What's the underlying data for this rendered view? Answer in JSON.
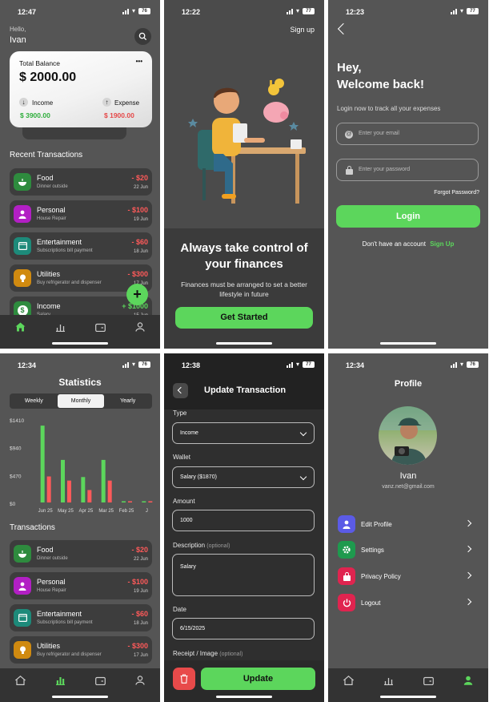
{
  "colors": {
    "green": "#5cd65c",
    "red": "#ff5a5a",
    "bg": "#555555",
    "dark": "#333333"
  },
  "s1": {
    "time": "12:47",
    "battery": "76",
    "greeting": "Hello,",
    "name": "Ivan",
    "balance_label": "Total Balance",
    "balance": "$ 2000.00",
    "more": "•••",
    "income_label": "Income",
    "income": "$ 3900.00",
    "expense_label": "Expense",
    "expense": "$ 1900.00",
    "section": "Recent Transactions",
    "transactions": [
      {
        "name": "Food",
        "sub": "Dinner outside",
        "amount": "- $20",
        "date": "22 Jun",
        "icon": "food-icon",
        "color": "#2e8b3e"
      },
      {
        "name": "Personal",
        "sub": "House Repair",
        "amount": "- $100",
        "date": "19 Jun",
        "icon": "person-icon",
        "color": "#b21fc4"
      },
      {
        "name": "Entertainment",
        "sub": "Subscriptions bill payment",
        "amount": "- $60",
        "date": "18 Jun",
        "icon": "entertainment-icon",
        "color": "#1d8a7a"
      },
      {
        "name": "Utilities",
        "sub": "Buy refrigerator and dispenser",
        "amount": "- $300",
        "date": "17 Jun",
        "icon": "bulb-icon",
        "color": "#d08a10"
      },
      {
        "name": "Income",
        "sub": "Salary",
        "amount": "+ $1000",
        "date": "15 Jun",
        "icon": "dollar-icon",
        "color": "#2e8b3e"
      }
    ],
    "fab": "+"
  },
  "s2": {
    "time": "12:22",
    "battery": "77",
    "signup": "Sign up",
    "headline": "Always take control of your finances",
    "body": "Finances must be arranged to set a better lifestyle in future",
    "cta": "Get Started"
  },
  "s3": {
    "time": "12:23",
    "battery": "77",
    "title1": "Hey,",
    "title2": "Welcome back!",
    "subtitle": "Login now to track all your expenses",
    "email_ph": "Enter your email",
    "password_ph": "Enter your password",
    "forgot": "Forgot Password?",
    "login": "Login",
    "no_account": "Don't have an account",
    "signup": "Sign Up"
  },
  "s4": {
    "time": "12:34",
    "battery": "76",
    "title": "Statistics",
    "periods": [
      "Weekly",
      "Monthly",
      "Yearly"
    ],
    "section": "Transactions",
    "transactions": [
      {
        "name": "Food",
        "sub": "Dinner outside",
        "amount": "- $20",
        "date": "22 Jun",
        "icon": "food-icon",
        "color": "#2e8b3e"
      },
      {
        "name": "Personal",
        "sub": "House Repair",
        "amount": "- $100",
        "date": "19 Jun",
        "icon": "person-icon",
        "color": "#b21fc4"
      },
      {
        "name": "Entertainment",
        "sub": "Subscriptions bill payment",
        "amount": "- $60",
        "date": "18 Jun",
        "icon": "entertainment-icon",
        "color": "#1d8a7a"
      },
      {
        "name": "Utilities",
        "sub": "Buy refrigerator and dispenser",
        "amount": "- $300",
        "date": "17 Jun",
        "icon": "bulb-icon",
        "color": "#d08a10"
      }
    ]
  },
  "chart_data": {
    "type": "bar",
    "categories": [
      "Jun 25",
      "May 25",
      "Apr 25",
      "Mar 25",
      "Feb 25",
      "J"
    ],
    "series": [
      {
        "values": [
          1300,
          720,
          430,
          720,
          0,
          0
        ],
        "color": "#5cd65c"
      },
      {
        "values": [
          440,
          370,
          210,
          370,
          0,
          0
        ],
        "color": "#ff5a5a"
      }
    ],
    "yticks": [
      "$1410",
      "$940",
      "$470",
      "$0"
    ],
    "ylim": [
      0,
      1410
    ]
  },
  "s5": {
    "time": "12:38",
    "battery": "77",
    "title": "Update Transaction",
    "type_label": "Type",
    "type_value": "Income",
    "wallet_label": "Wallet",
    "wallet_value": "Salary ($1870)",
    "amount_label": "Amount",
    "amount_value": "1000",
    "desc_label": "Description",
    "desc_optional": "(optional)",
    "desc_value": "Salary",
    "date_label": "Date",
    "date_value": "6/15/2025",
    "receipt_label": "Receipt / Image",
    "receipt_optional": "(optional)",
    "update": "Update"
  },
  "s6": {
    "time": "12:34",
    "battery": "76",
    "title": "Profile",
    "name": "Ivan",
    "email": "vanz.net@gmail.com",
    "menu": [
      {
        "label": "Edit Profile",
        "icon": "user-icon",
        "color": "#5b5be6"
      },
      {
        "label": "Settings",
        "icon": "gear-icon",
        "color": "#1e9a4e"
      },
      {
        "label": "Privacy Policy",
        "icon": "lock-icon",
        "color": "#e0244f"
      },
      {
        "label": "Logout",
        "icon": "power-icon",
        "color": "#e0244f"
      }
    ]
  }
}
